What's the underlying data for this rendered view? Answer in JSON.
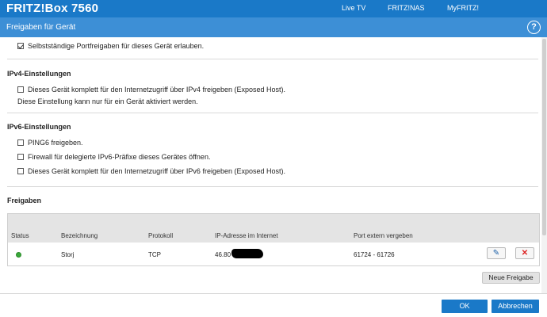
{
  "header": {
    "brand": "FRITZ!Box 7560",
    "nav": [
      "Live TV",
      "FRITZ!NAS",
      "MyFRITZ!"
    ]
  },
  "titlebar": {
    "title": "Freigaben für Gerät",
    "help_icon": "question-circle-icon",
    "help_glyph": "?"
  },
  "general": {
    "allow_self_port_label": "Selbstständige Portfreigaben für dieses Gerät erlauben.",
    "allow_self_port_checked": true
  },
  "ipv4": {
    "title": "IPv4-Einstellungen",
    "exposed_host_label": "Dieses Gerät komplett für den Internetzugriff über IPv4 freigeben (Exposed Host).",
    "exposed_host_checked": false,
    "note": "Diese Einstellung kann nur für ein Gerät aktiviert werden."
  },
  "ipv6": {
    "title": "IPv6-Einstellungen",
    "options": [
      {
        "label": "PING6 freigeben.",
        "checked": false
      },
      {
        "label": "Firewall für delegierte IPv6-Präfixe dieses Gerätes öffnen.",
        "checked": false
      },
      {
        "label": "Dieses Gerät komplett für den Internetzugriff über IPv6 freigeben (Exposed Host).",
        "checked": false
      }
    ]
  },
  "freigaben": {
    "title": "Freigaben",
    "columns": {
      "status": "Status",
      "bezeichnung": "Bezeichnung",
      "protokoll": "Protokoll",
      "ip": "IP-Adresse im Internet",
      "port": "Port extern vergeben"
    },
    "rows": [
      {
        "status_color": "#3aa83a",
        "bezeichnung": "Storj",
        "protokoll": "TCP",
        "ip_visible": "46.80",
        "port": "61724 - 61726",
        "edit_icon": "pencil-icon",
        "edit_glyph": "✎",
        "delete_icon": "close-x-icon",
        "delete_glyph": "✕"
      }
    ],
    "new_button": "Neue Freigabe"
  },
  "footer": {
    "ok": "OK",
    "cancel": "Abbrechen"
  },
  "colors": {
    "brand_blue": "#1a79c8",
    "title_blue": "#3d8fd6"
  }
}
